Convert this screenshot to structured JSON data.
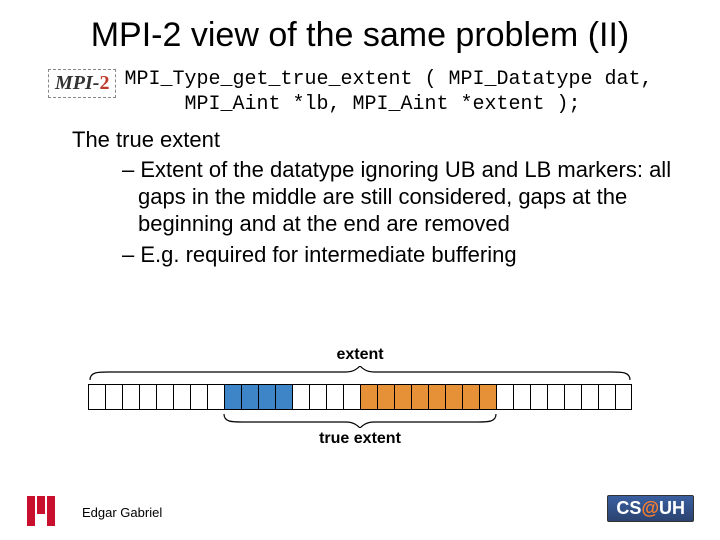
{
  "title": "MPI-2 view of the same problem (II)",
  "badge": {
    "prefix": "MPI-",
    "suffix": "2"
  },
  "code": {
    "line1": "MPI_Type_get_true_extent ( MPI_Datatype dat,",
    "line2": "     MPI_Aint *lb, MPI_Aint *extent );"
  },
  "subhead": "The true extent",
  "bullets": [
    "– Extent of the datatype ignoring UB and LB markers: all gaps in the middle are still considered, gaps at the beginning and at the end are removed",
    "– E.g. required for intermediate buffering"
  ],
  "diagram": {
    "extent_label": "extent",
    "true_extent_label": "true extent",
    "cells": [
      "w",
      "w",
      "w",
      "w",
      "w",
      "w",
      "w",
      "w",
      "b",
      "b",
      "b",
      "b",
      "w",
      "w",
      "w",
      "w",
      "o",
      "o",
      "o",
      "o",
      "o",
      "o",
      "o",
      "o",
      "w",
      "w",
      "w",
      "w",
      "w",
      "w",
      "w",
      "w"
    ],
    "true_start": 8,
    "true_end": 24
  },
  "author": "Edgar Gabriel",
  "csuh": {
    "cs": "CS",
    "at": "@",
    "uh": "UH"
  }
}
